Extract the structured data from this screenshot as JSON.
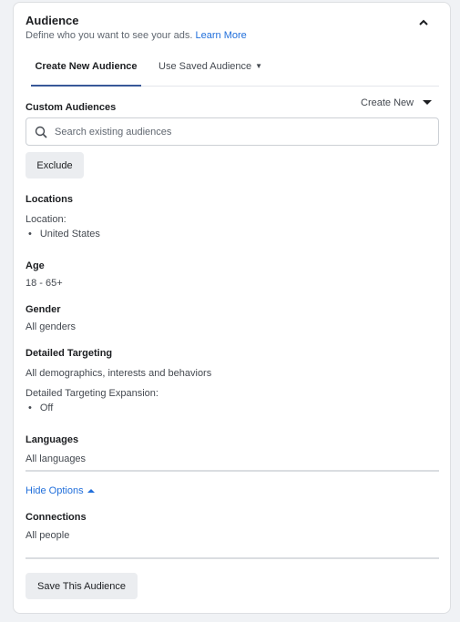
{
  "header": {
    "title": "Audience",
    "subtitle": "Define who you want to see your ads.",
    "learn_more": "Learn More"
  },
  "tabs": [
    {
      "label": "Create New Audience",
      "active": true
    },
    {
      "label": "Use Saved Audience",
      "active": false
    }
  ],
  "custom_audiences": {
    "label": "Custom Audiences",
    "create_new": "Create New",
    "search_placeholder": "Search existing audiences",
    "exclude": "Exclude"
  },
  "locations": {
    "label": "Locations",
    "sublabel": "Location:",
    "items": [
      "United States"
    ]
  },
  "age": {
    "label": "Age",
    "value": "18 - 65+"
  },
  "gender": {
    "label": "Gender",
    "value": "All genders"
  },
  "detailed_targeting": {
    "label": "Detailed Targeting",
    "value": "All demographics, interests and behaviors",
    "expansion_label": "Detailed Targeting Expansion:",
    "expansion_items": [
      "Off"
    ]
  },
  "languages": {
    "label": "Languages",
    "value": "All languages"
  },
  "hide_options": "Hide Options",
  "connections": {
    "label": "Connections",
    "value": "All people"
  },
  "save_audience": "Save This Audience",
  "icons": {
    "collapse": "chevron-up-icon",
    "dropdown": "caret-down-icon",
    "search": "search-icon",
    "hide_options": "caret-up-icon"
  },
  "colors": {
    "link": "#216fdb",
    "tab_underline": "#385898",
    "page_bg": "#f0f2f5"
  }
}
